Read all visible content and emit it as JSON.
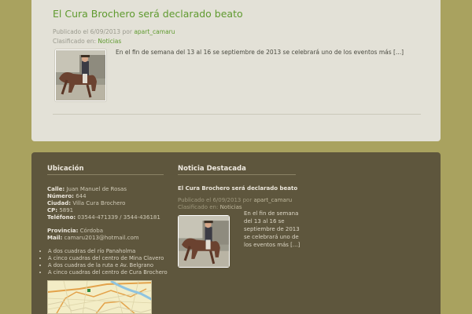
{
  "post": {
    "title": "El Cura Brochero será declarado beato",
    "published_prefix": "Publicado el",
    "date": "6/09/2013",
    "by": "por",
    "author": "apart_camaru",
    "classified_prefix": "Clasificado en:",
    "category": "Noticias",
    "excerpt": "En el fin de semana del 13 al 16 se septiembre de 2013 se celebrará uno de los eventos más [...]"
  },
  "footer": {
    "location": {
      "title": "Ubicación",
      "fields": [
        {
          "label": "Calle:",
          "value": "Juan Manuel de Rosas"
        },
        {
          "label": "Número:",
          "value": "644"
        },
        {
          "label": "Ciudad:",
          "value": "Villa Cura Brochero"
        },
        {
          "label": "CP:",
          "value": "5891"
        },
        {
          "label": "Teléfono:",
          "value": "03544-471339 / 3544-436181"
        }
      ],
      "fields2": [
        {
          "label": "Provincia:",
          "value": "Córdoba"
        },
        {
          "label": "Mail:",
          "value": "camaru2013@hotmail.com"
        }
      ],
      "bullets": [
        "A dos cuadras del río Panaholma",
        "A cinco cuadras del centro de Mina Clavero",
        "A dos cuadras de la ruta e Av. Belgrano",
        "A cinco cuadras del centro de Cura Brochero"
      ]
    },
    "featured": {
      "title": "Noticia Destacada",
      "post_title": "El Cura Brochero será declarado beato",
      "published_prefix": "Publicado el",
      "date": "6/09/2013",
      "by": "por",
      "author": "apart_camaru",
      "classified_prefix": "Clasificado en:",
      "category": "Noticias",
      "excerpt": "En el fin de semana del 13 al 16 se septiembre de 2013 se celebrará uno de los eventos más [...]"
    }
  },
  "colors": {
    "background": "#a9a25f",
    "card": "#e3e1d7",
    "footer": "#5e563d",
    "link": "#5f9a2f"
  },
  "icons": [
    "horse-rider-photo",
    "map-thumbnail"
  ]
}
